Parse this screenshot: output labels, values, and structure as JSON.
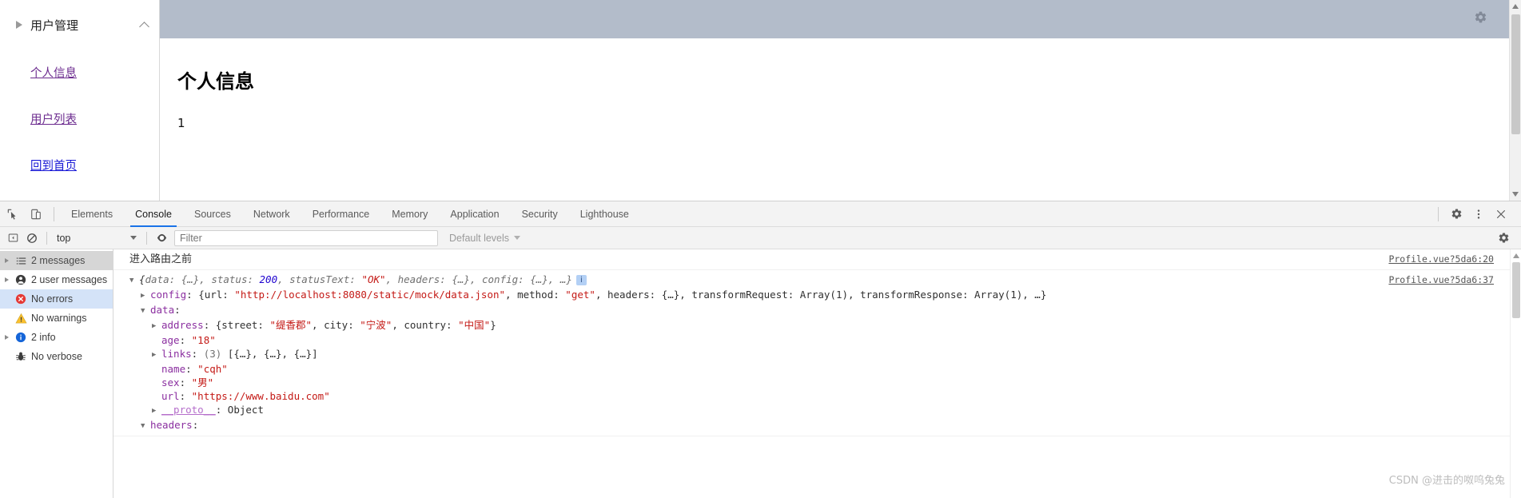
{
  "app": {
    "nav": {
      "group_label": "用户管理",
      "expand_icon": "triangle-right-icon",
      "collapse_icon": "chevron-up-icon",
      "links": [
        {
          "label": "个人信息",
          "state": "visited"
        },
        {
          "label": "用户列表",
          "state": "visited"
        },
        {
          "label": "回到首页",
          "state": "unvisited"
        }
      ]
    },
    "content": {
      "banner_gear_icon": "gear-icon",
      "heading": "个人信息",
      "value": "1"
    }
  },
  "devtools": {
    "tabbar": {
      "inspect_icon": "inspect-element-icon",
      "device_icon": "device-toolbar-icon",
      "tabs": [
        {
          "label": "Elements",
          "active": false
        },
        {
          "label": "Console",
          "active": true
        },
        {
          "label": "Sources",
          "active": false
        },
        {
          "label": "Network",
          "active": false
        },
        {
          "label": "Performance",
          "active": false
        },
        {
          "label": "Memory",
          "active": false
        },
        {
          "label": "Application",
          "active": false
        },
        {
          "label": "Security",
          "active": false
        },
        {
          "label": "Lighthouse",
          "active": false
        }
      ],
      "right_icons": [
        {
          "name": "gear-icon"
        },
        {
          "name": "more-vertical-icon"
        },
        {
          "name": "close-icon"
        }
      ]
    },
    "filterbar": {
      "sidebar_toggle_icon": "console-sidebar-toggle-icon",
      "clear_icon": "clear-console-icon",
      "context_selected": "top",
      "eye_icon": "live-expression-icon",
      "filter_placeholder": "Filter",
      "filter_value": "",
      "levels_label": "Default levels",
      "settings_icon": "console-settings-gear-icon"
    },
    "sidebar": {
      "items": [
        {
          "label": "2 messages",
          "icon": "list-icon",
          "expandable": true,
          "selected": "grey"
        },
        {
          "label": "2 user messages",
          "icon": "user-icon",
          "expandable": true,
          "selected": "none"
        },
        {
          "label": "No errors",
          "icon": "error-icon",
          "expandable": false,
          "selected": "blue"
        },
        {
          "label": "No warnings",
          "icon": "warning-icon",
          "expandable": false,
          "selected": "none"
        },
        {
          "label": "2 info",
          "icon": "info-icon",
          "expandable": true,
          "selected": "none"
        },
        {
          "label": "No verbose",
          "icon": "bug-icon",
          "expandable": false,
          "selected": "none"
        }
      ]
    },
    "console": {
      "message1": {
        "text": "进入路由之前",
        "source": "Profile.vue?5da6:20"
      },
      "message2": {
        "source": "Profile.vue?5da6:37",
        "summary": {
          "open_brace": "{",
          "p1_key": "data: ",
          "p1_val": "{…}",
          "p2_key": ", status: ",
          "p2_val": "200",
          "p3_key": ", statusText: ",
          "p3_val": "\"OK\"",
          "p4_key": ", headers: ",
          "p4_val": "{…}",
          "p5_key": ", config: ",
          "p5_val": "{…}",
          "tail": ", …}",
          "badge": "i"
        },
        "config_line": {
          "key": "config",
          "open": ": {url: ",
          "url": "\"http://localhost:8080/static/mock/data.json\"",
          "mid1": ", method: ",
          "method": "\"get\"",
          "mid2": ", headers: {…}, transformRequest: Array(1), transformResponse: Array(1), …}"
        },
        "data_label": "data",
        "data_props": {
          "address_key": "address",
          "address_open": ": {street: ",
          "address_street": "\"缇香郡\"",
          "address_mid1": ", city: ",
          "address_city": "\"宁波\"",
          "address_mid2": ", country: ",
          "address_country": "\"中国\"",
          "address_close": "}",
          "age_key": "age",
          "age_val": "\"18\"",
          "links_key": "links",
          "links_count": "(3)",
          "links_val": "[{…}, {…}, {…}]",
          "name_key": "name",
          "name_val": "\"cqh\"",
          "sex_key": "sex",
          "sex_val": "\"男\"",
          "url_key": "url",
          "url_val": "\"https://www.baidu.com\"",
          "proto_key": "__proto__",
          "proto_val": "Object"
        },
        "headers_label": "headers"
      }
    }
  },
  "watermark": "CSDN @进击的呶呜兔兔"
}
